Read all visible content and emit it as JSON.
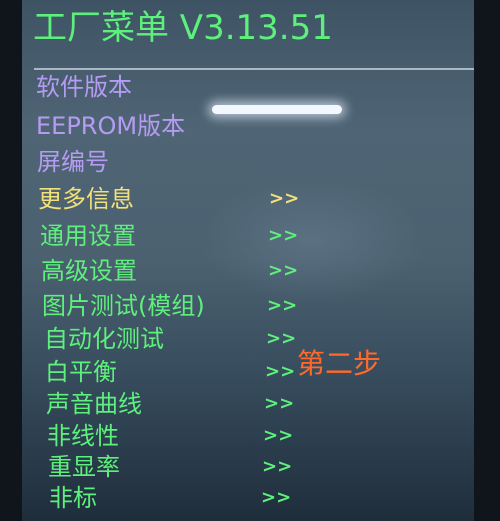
{
  "menu": {
    "title": "工厂菜单 V3.13.51",
    "items": [
      {
        "label": "软件版本",
        "arrow": ""
      },
      {
        "label": "EEPROM版本",
        "arrow": ""
      },
      {
        "label": "屏编号",
        "arrow": ""
      },
      {
        "label": "更多信息",
        "arrow": ">>"
      },
      {
        "label": "通用设置",
        "arrow": ">>"
      },
      {
        "label": "高级设置",
        "arrow": ">>"
      },
      {
        "label": "图片测试(模组)",
        "arrow": ">>"
      },
      {
        "label": "自动化测试",
        "arrow": ">>"
      },
      {
        "label": "白平衡",
        "arrow": ">>"
      },
      {
        "label": "声音曲线",
        "arrow": ">>"
      },
      {
        "label": "非线性",
        "arrow": ">>"
      },
      {
        "label": "重显率",
        "arrow": ">>"
      },
      {
        "label": "非标",
        "arrow": ">>"
      }
    ]
  },
  "annotation": {
    "text": "第二步"
  },
  "colors": {
    "title_green": "#5ef07c",
    "info_purple": "#b59cf2",
    "selected_yellow": "#f2e07a",
    "item_green": "#5ef07c",
    "annotation_orange": "#ff6a2a"
  }
}
